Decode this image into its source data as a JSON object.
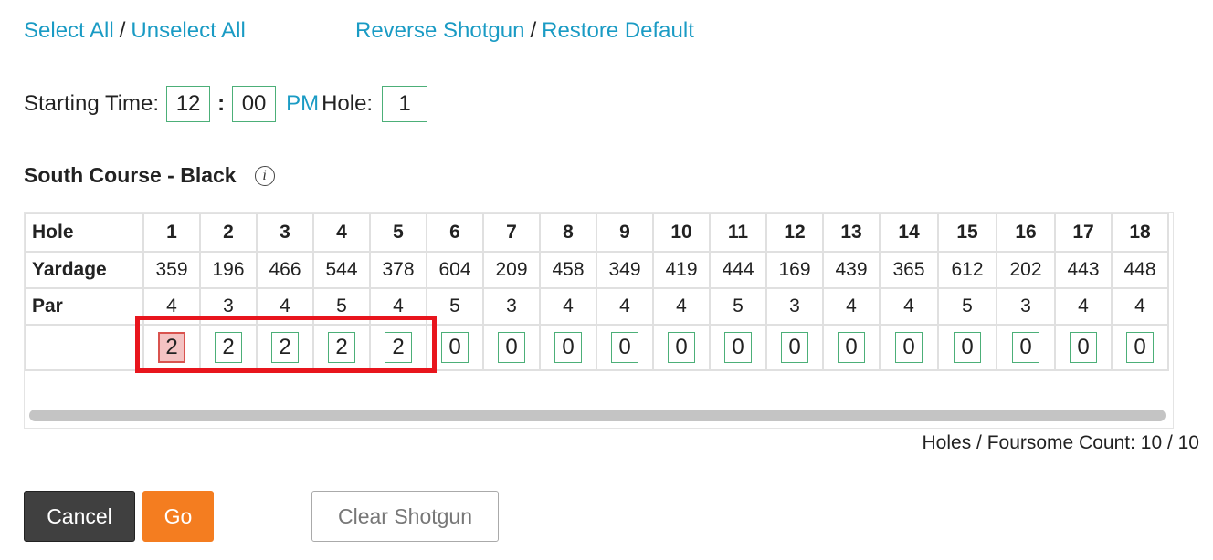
{
  "links": {
    "select_all": "Select All",
    "unselect_all": "Unselect All",
    "reverse_shotgun": "Reverse Shotgun",
    "restore_default": "Restore Default",
    "separator": "/"
  },
  "start": {
    "label": "Starting Time:",
    "hour": "12",
    "minute": "00",
    "colon": ":",
    "ampm": "PM",
    "hole_label": "Hole:",
    "hole": "1"
  },
  "course": {
    "title": "South Course - Black",
    "info_icon": "info-icon",
    "info_glyph": "i"
  },
  "table": {
    "row_labels": {
      "hole": "Hole",
      "yardage": "Yardage",
      "par": "Par"
    },
    "holes": [
      "1",
      "2",
      "3",
      "4",
      "5",
      "6",
      "7",
      "8",
      "9",
      "10",
      "11",
      "12",
      "13",
      "14",
      "15",
      "16",
      "17",
      "18"
    ],
    "yardage": [
      "359",
      "196",
      "466",
      "544",
      "378",
      "604",
      "209",
      "458",
      "349",
      "419",
      "444",
      "169",
      "439",
      "365",
      "612",
      "202",
      "443",
      "448"
    ],
    "par": [
      "4",
      "3",
      "4",
      "5",
      "4",
      "5",
      "3",
      "4",
      "4",
      "4",
      "5",
      "3",
      "4",
      "4",
      "5",
      "3",
      "4",
      "4"
    ],
    "counts": [
      "2",
      "2",
      "2",
      "2",
      "2",
      "0",
      "0",
      "0",
      "0",
      "0",
      "0",
      "0",
      "0",
      "0",
      "0",
      "0",
      "0",
      "0"
    ],
    "invalid_index": 0
  },
  "count_text": "Holes / Foursome Count: 10 / 10",
  "buttons": {
    "cancel": "Cancel",
    "go": "Go",
    "clear_shotgun": "Clear Shotgun"
  },
  "colors": {
    "link": "#1a9bc4",
    "input_border": "#4caf78",
    "highlight": "#e8151d",
    "go": "#f47d20",
    "cancel": "#404040"
  }
}
